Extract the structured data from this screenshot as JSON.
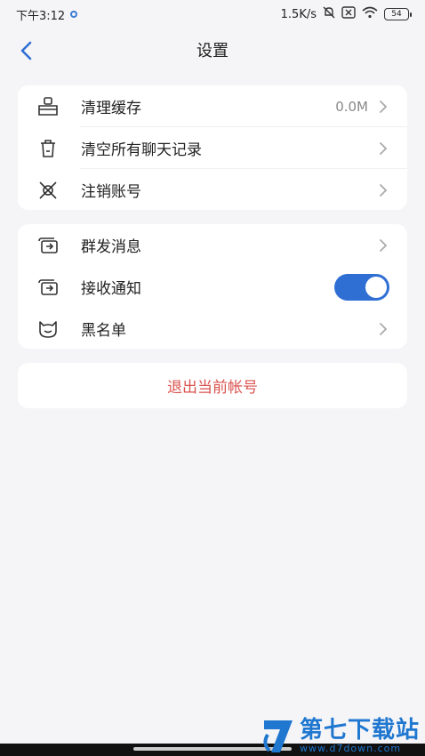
{
  "status_bar": {
    "time": "下午3:12",
    "network_speed": "1.5K/s",
    "battery": "54",
    "icons": [
      "sync-dot-icon",
      "mute-icon",
      "sim-icon",
      "wifi-icon",
      "battery-icon"
    ]
  },
  "nav": {
    "title": "设置",
    "back_icon": "chevron-left-icon"
  },
  "group1": {
    "items": [
      {
        "label": "清理缓存",
        "value": "0.0M",
        "icon": "broom-icon"
      },
      {
        "label": "清空所有聊天记录",
        "icon": "trash-icon"
      },
      {
        "label": "注销账号",
        "icon": "cross-user-icon"
      }
    ]
  },
  "group2": {
    "items": [
      {
        "label": "群发消息",
        "icon": "broadcast-icon"
      },
      {
        "label": "接收通知",
        "icon": "notification-icon",
        "toggle_on": true
      },
      {
        "label": "黑名单",
        "icon": "cat-face-icon"
      }
    ]
  },
  "logout": {
    "label": "退出当前帐号"
  },
  "colors": {
    "accent": "#2f6fd4",
    "danger": "#d9534f",
    "background": "#f5f5f7"
  },
  "watermark": {
    "title": "第七下载站",
    "url": "www.d7down.com"
  }
}
